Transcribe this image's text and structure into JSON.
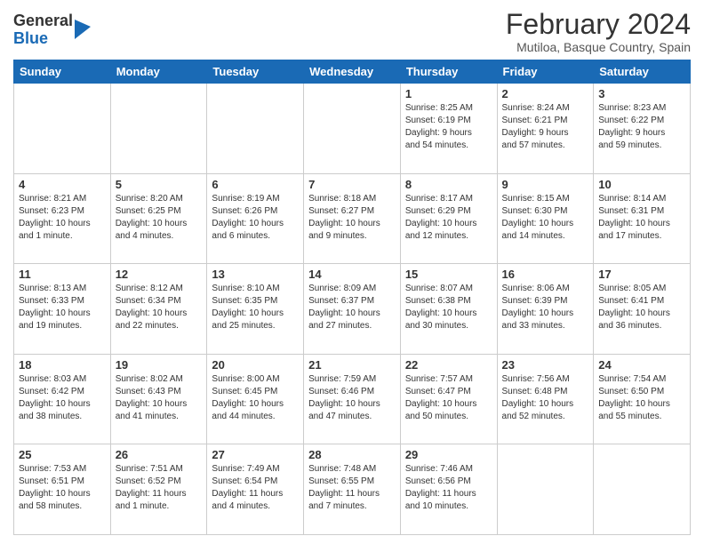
{
  "logo": {
    "general": "General",
    "blue": "Blue"
  },
  "title": "February 2024",
  "subtitle": "Mutiloa, Basque Country, Spain",
  "days_of_week": [
    "Sunday",
    "Monday",
    "Tuesday",
    "Wednesday",
    "Thursday",
    "Friday",
    "Saturday"
  ],
  "weeks": [
    [
      {
        "num": "",
        "info": ""
      },
      {
        "num": "",
        "info": ""
      },
      {
        "num": "",
        "info": ""
      },
      {
        "num": "",
        "info": ""
      },
      {
        "num": "1",
        "info": "Sunrise: 8:25 AM\nSunset: 6:19 PM\nDaylight: 9 hours\nand 54 minutes."
      },
      {
        "num": "2",
        "info": "Sunrise: 8:24 AM\nSunset: 6:21 PM\nDaylight: 9 hours\nand 57 minutes."
      },
      {
        "num": "3",
        "info": "Sunrise: 8:23 AM\nSunset: 6:22 PM\nDaylight: 9 hours\nand 59 minutes."
      }
    ],
    [
      {
        "num": "4",
        "info": "Sunrise: 8:21 AM\nSunset: 6:23 PM\nDaylight: 10 hours\nand 1 minute."
      },
      {
        "num": "5",
        "info": "Sunrise: 8:20 AM\nSunset: 6:25 PM\nDaylight: 10 hours\nand 4 minutes."
      },
      {
        "num": "6",
        "info": "Sunrise: 8:19 AM\nSunset: 6:26 PM\nDaylight: 10 hours\nand 6 minutes."
      },
      {
        "num": "7",
        "info": "Sunrise: 8:18 AM\nSunset: 6:27 PM\nDaylight: 10 hours\nand 9 minutes."
      },
      {
        "num": "8",
        "info": "Sunrise: 8:17 AM\nSunset: 6:29 PM\nDaylight: 10 hours\nand 12 minutes."
      },
      {
        "num": "9",
        "info": "Sunrise: 8:15 AM\nSunset: 6:30 PM\nDaylight: 10 hours\nand 14 minutes."
      },
      {
        "num": "10",
        "info": "Sunrise: 8:14 AM\nSunset: 6:31 PM\nDaylight: 10 hours\nand 17 minutes."
      }
    ],
    [
      {
        "num": "11",
        "info": "Sunrise: 8:13 AM\nSunset: 6:33 PM\nDaylight: 10 hours\nand 19 minutes."
      },
      {
        "num": "12",
        "info": "Sunrise: 8:12 AM\nSunset: 6:34 PM\nDaylight: 10 hours\nand 22 minutes."
      },
      {
        "num": "13",
        "info": "Sunrise: 8:10 AM\nSunset: 6:35 PM\nDaylight: 10 hours\nand 25 minutes."
      },
      {
        "num": "14",
        "info": "Sunrise: 8:09 AM\nSunset: 6:37 PM\nDaylight: 10 hours\nand 27 minutes."
      },
      {
        "num": "15",
        "info": "Sunrise: 8:07 AM\nSunset: 6:38 PM\nDaylight: 10 hours\nand 30 minutes."
      },
      {
        "num": "16",
        "info": "Sunrise: 8:06 AM\nSunset: 6:39 PM\nDaylight: 10 hours\nand 33 minutes."
      },
      {
        "num": "17",
        "info": "Sunrise: 8:05 AM\nSunset: 6:41 PM\nDaylight: 10 hours\nand 36 minutes."
      }
    ],
    [
      {
        "num": "18",
        "info": "Sunrise: 8:03 AM\nSunset: 6:42 PM\nDaylight: 10 hours\nand 38 minutes."
      },
      {
        "num": "19",
        "info": "Sunrise: 8:02 AM\nSunset: 6:43 PM\nDaylight: 10 hours\nand 41 minutes."
      },
      {
        "num": "20",
        "info": "Sunrise: 8:00 AM\nSunset: 6:45 PM\nDaylight: 10 hours\nand 44 minutes."
      },
      {
        "num": "21",
        "info": "Sunrise: 7:59 AM\nSunset: 6:46 PM\nDaylight: 10 hours\nand 47 minutes."
      },
      {
        "num": "22",
        "info": "Sunrise: 7:57 AM\nSunset: 6:47 PM\nDaylight: 10 hours\nand 50 minutes."
      },
      {
        "num": "23",
        "info": "Sunrise: 7:56 AM\nSunset: 6:48 PM\nDaylight: 10 hours\nand 52 minutes."
      },
      {
        "num": "24",
        "info": "Sunrise: 7:54 AM\nSunset: 6:50 PM\nDaylight: 10 hours\nand 55 minutes."
      }
    ],
    [
      {
        "num": "25",
        "info": "Sunrise: 7:53 AM\nSunset: 6:51 PM\nDaylight: 10 hours\nand 58 minutes."
      },
      {
        "num": "26",
        "info": "Sunrise: 7:51 AM\nSunset: 6:52 PM\nDaylight: 11 hours\nand 1 minute."
      },
      {
        "num": "27",
        "info": "Sunrise: 7:49 AM\nSunset: 6:54 PM\nDaylight: 11 hours\nand 4 minutes."
      },
      {
        "num": "28",
        "info": "Sunrise: 7:48 AM\nSunset: 6:55 PM\nDaylight: 11 hours\nand 7 minutes."
      },
      {
        "num": "29",
        "info": "Sunrise: 7:46 AM\nSunset: 6:56 PM\nDaylight: 11 hours\nand 10 minutes."
      },
      {
        "num": "",
        "info": ""
      },
      {
        "num": "",
        "info": ""
      }
    ]
  ]
}
